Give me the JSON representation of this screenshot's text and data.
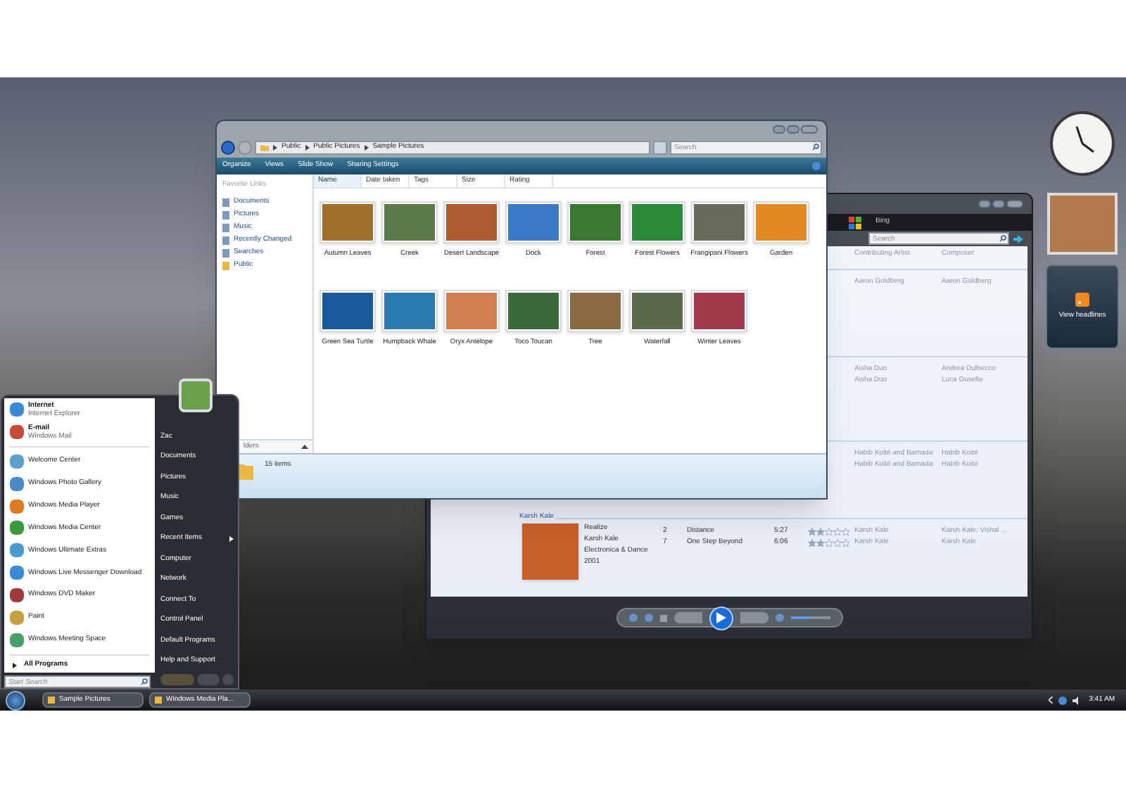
{
  "explorer": {
    "breadcrumb": [
      "Public",
      "Public Pictures",
      "Sample Pictures"
    ],
    "search": {
      "placeholder": "Search"
    },
    "toolbar": [
      "Organize",
      "Views",
      "Slide Show",
      "Sharing Settings"
    ],
    "favorite_links_title": "Favorite Links",
    "favorite_links": [
      "Documents",
      "Pictures",
      "Music",
      "Recently Changed",
      "Searches",
      "Public"
    ],
    "folders_label": "lders",
    "columns": [
      "Name",
      "Date taken",
      "Tags",
      "Size",
      "Rating"
    ],
    "items": [
      "Autumn Leaves",
      "Creek",
      "Desert Landscape",
      "Dock",
      "Forest",
      "Forest Flowers",
      "Frangipani Flowers",
      "Garden",
      "Green Sea Turtle",
      "Humpback Whale",
      "Oryx Antelope",
      "Toco Toucan",
      "Tree",
      "Waterfall",
      "Winter Leaves"
    ],
    "status": "15 items"
  },
  "media_player": {
    "title": "Bing",
    "search": {
      "placeholder": "Search"
    },
    "columns": [
      "Contributing Artist",
      "Composer"
    ],
    "groups": [
      {
        "tracks": [
          {
            "artist": "Aaron Goldberg",
            "composer": "Aaron Goldberg"
          }
        ]
      },
      {
        "tracks": [
          {
            "artist": "Aisha Duo",
            "composer": "Andrea Dulbecco"
          },
          {
            "artist": "Aisha Duo",
            "composer": "Luca Gusella"
          }
        ]
      },
      {
        "tracks": [
          {
            "artist": "Habib Koité and Bamada",
            "composer": "Habib Koité"
          },
          {
            "artist": "Habib Koité and Bamada",
            "composer": "Habib Koité"
          }
        ]
      },
      {
        "header": "Karsh Kale",
        "album": [
          "Realize",
          "Karsh Kale",
          "Electronica & Dance",
          "2001"
        ],
        "tracks": [
          {
            "number": "2",
            "title": "Distance",
            "length": "5:27",
            "stars": 2,
            "artist": "Karsh Kale",
            "composer": "Karsh Kale; Vishal ..."
          },
          {
            "number": "7",
            "title": "One Step Beyond",
            "length": "6:06",
            "stars": 2,
            "artist": "Karsh Kale",
            "composer": "Karsh Kale"
          }
        ]
      }
    ],
    "volume": {
      "level": 0.5
    }
  },
  "start_menu": {
    "pinned": [
      {
        "title": "Internet",
        "subtitle": "Internet Explorer"
      },
      {
        "title": "E-mail",
        "subtitle": "Windows Mail"
      }
    ],
    "programs": [
      "Welcome Center",
      "Windows Photo Gallery",
      "Windows Media Player",
      "Windows Media Center",
      "Windows Ultimate Extras",
      "Windows Live Messenger Download",
      "Windows DVD Maker",
      "Paint",
      "Windows Meeting Space"
    ],
    "all_programs": "All Programs",
    "search": {
      "placeholder": "Start Search"
    },
    "places": [
      {
        "label": "Zac",
        "submenu": false
      },
      {
        "label": "Documents",
        "submenu": false
      },
      {
        "label": "Pictures",
        "submenu": false
      },
      {
        "label": "Music",
        "submenu": false
      },
      {
        "label": "Games",
        "submenu": false
      },
      {
        "label": "Recent Items",
        "submenu": true
      },
      {
        "label": "Computer",
        "submenu": false
      },
      {
        "label": "Network",
        "submenu": false
      },
      {
        "label": "Connect To",
        "submenu": false
      },
      {
        "label": "Control Panel",
        "submenu": false
      },
      {
        "label": "Default Programs",
        "submenu": false
      },
      {
        "label": "Help and Support",
        "submenu": false
      }
    ]
  },
  "taskbar": {
    "buttons": [
      "Sample Pictures",
      "Windows Media Pla..."
    ],
    "clock": "3:41 AM"
  },
  "gadgets": {
    "feed": "View headlines"
  }
}
